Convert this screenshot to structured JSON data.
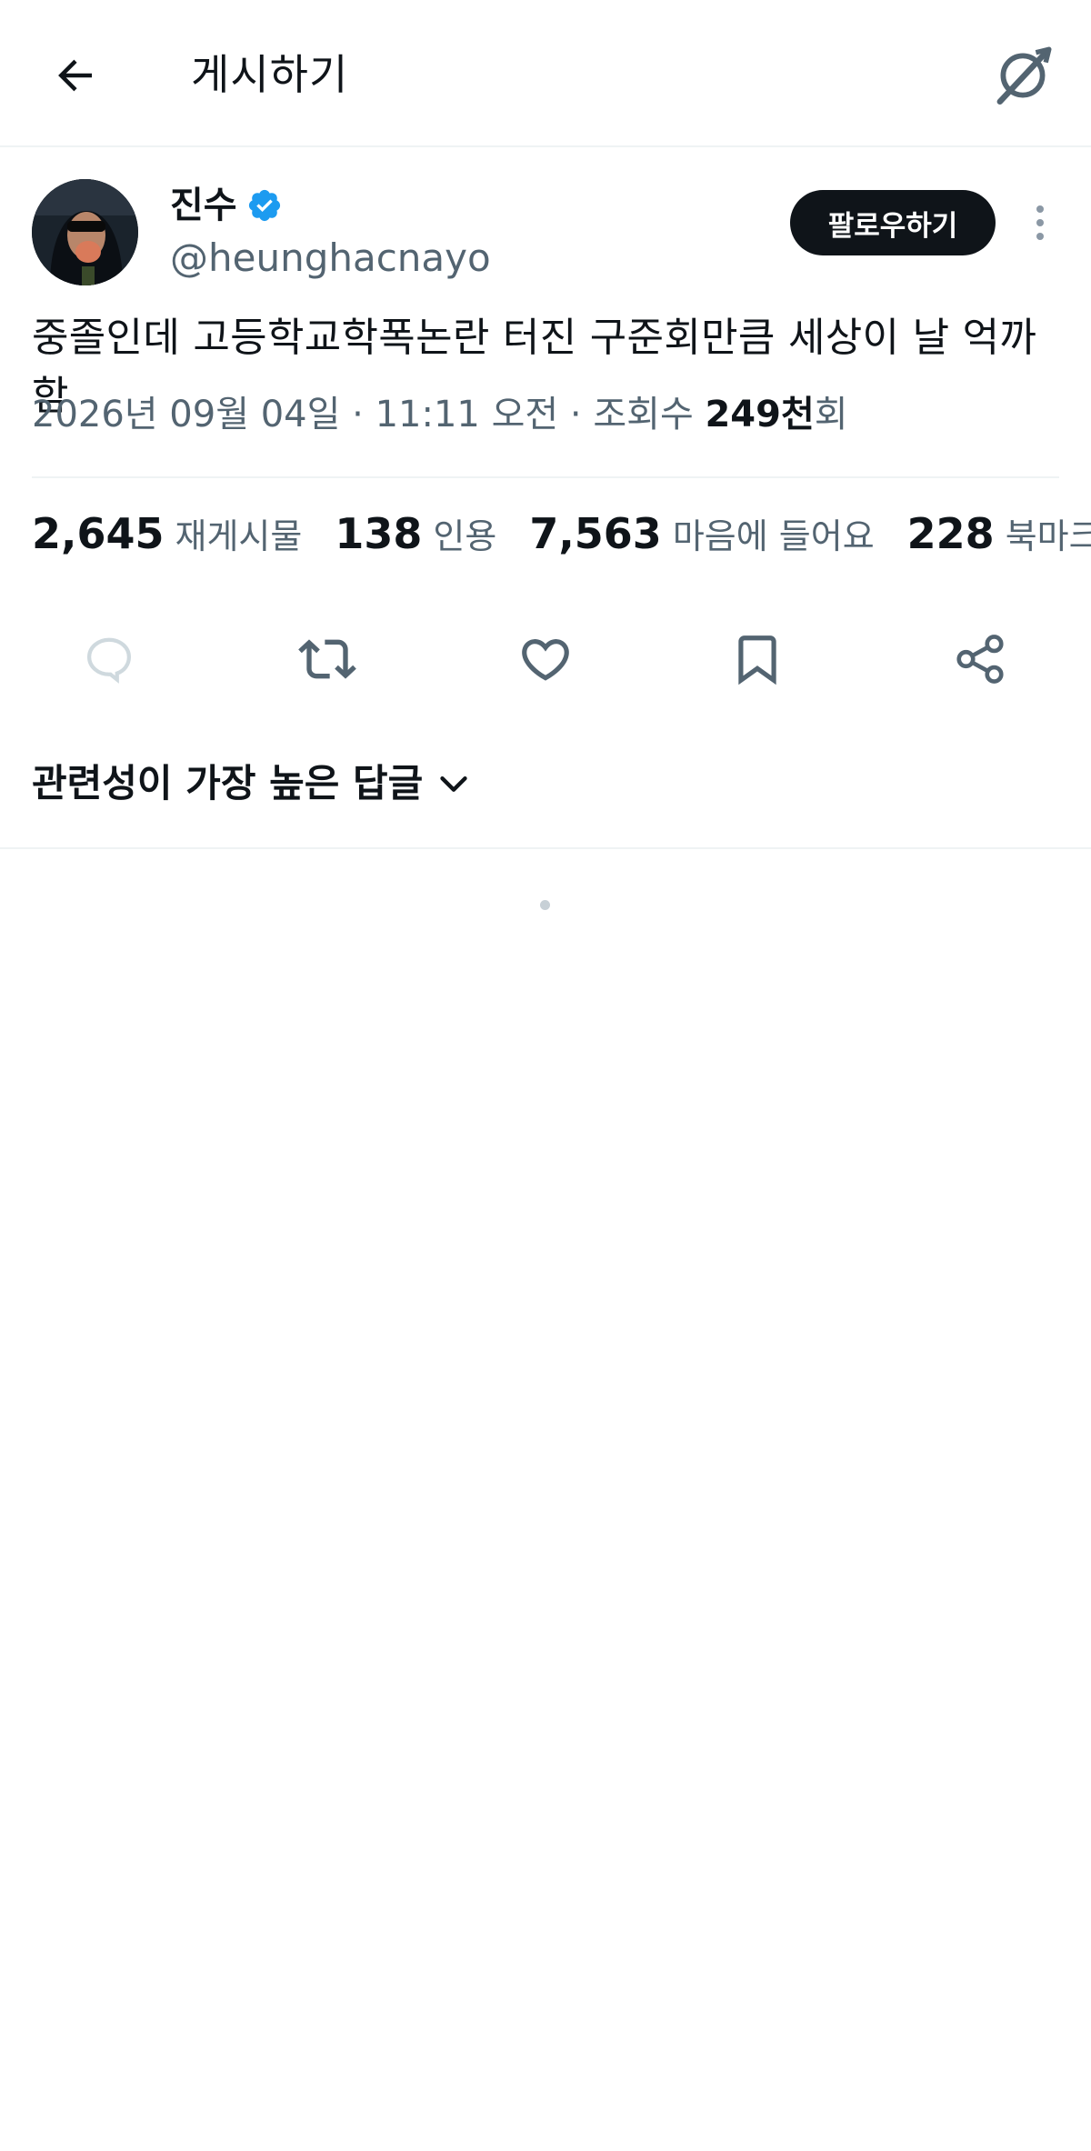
{
  "header": {
    "title": "게시하기",
    "back_icon": "arrow-left-icon",
    "grok_icon": "grok-icon"
  },
  "author": {
    "display_name": "진수",
    "handle": "@heunghacnayo",
    "verified": true,
    "verified_color": "#1d9bf0",
    "follow_label": "팔로우하기"
  },
  "post": {
    "text": "중졸인데 고등학교학폭논란 터진 구준회만큼 세상이 날 억까함",
    "date": "2026년 09월 04일",
    "time": "11:11 오전",
    "sep": "·",
    "views_label": "조회수",
    "views_value": "249천",
    "views_suffix": "회"
  },
  "stats": {
    "reposts": {
      "value": "2,645",
      "label": "재게시물"
    },
    "quotes": {
      "value": "138",
      "label": "인용"
    },
    "likes": {
      "value": "7,563",
      "label": "마음에 들어요"
    },
    "bookmarks": {
      "value": "228",
      "label": "북마크"
    }
  },
  "actions": [
    "reply-icon",
    "repost-icon",
    "like-icon",
    "bookmark-icon",
    "share-icon"
  ],
  "replies": {
    "sort_label": "관련성이 가장 높은 답글"
  },
  "colors": {
    "text": "#0f1419",
    "secondary": "#536471",
    "accent": "#1d9bf0",
    "divider": "#eff3f4"
  }
}
